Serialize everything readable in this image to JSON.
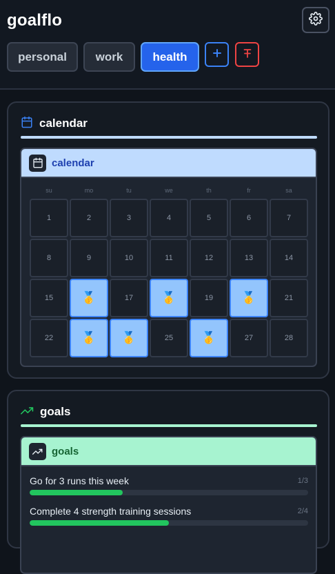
{
  "app": {
    "title": "goalflo"
  },
  "header": {
    "tabs": [
      {
        "label": "personal",
        "active": false
      },
      {
        "label": "work",
        "active": false
      },
      {
        "label": "health",
        "active": true
      }
    ],
    "add_icon": "plus",
    "delete_icon": "strikethrough-t",
    "settings_icon": "gear"
  },
  "calendar_section": {
    "title": "calendar",
    "card_title": "calendar",
    "weekdays": [
      "su",
      "mo",
      "tu",
      "we",
      "th",
      "fr",
      "sa"
    ],
    "days": [
      {
        "label": "1",
        "done": false
      },
      {
        "label": "2",
        "done": false
      },
      {
        "label": "3",
        "done": false
      },
      {
        "label": "4",
        "done": false
      },
      {
        "label": "5",
        "done": false
      },
      {
        "label": "6",
        "done": false
      },
      {
        "label": "7",
        "done": false
      },
      {
        "label": "8",
        "done": false
      },
      {
        "label": "9",
        "done": false
      },
      {
        "label": "10",
        "done": false
      },
      {
        "label": "11",
        "done": false
      },
      {
        "label": "12",
        "done": false
      },
      {
        "label": "13",
        "done": false
      },
      {
        "label": "14",
        "done": false
      },
      {
        "label": "15",
        "done": false
      },
      {
        "label": "🥇",
        "done": true
      },
      {
        "label": "17",
        "done": false
      },
      {
        "label": "🥇",
        "done": true
      },
      {
        "label": "19",
        "done": false
      },
      {
        "label": "🥇",
        "done": true
      },
      {
        "label": "21",
        "done": false
      },
      {
        "label": "22",
        "done": false
      },
      {
        "label": "🥇",
        "done": true
      },
      {
        "label": "🥇",
        "done": true
      },
      {
        "label": "25",
        "done": false
      },
      {
        "label": "🥇",
        "done": true
      },
      {
        "label": "27",
        "done": false
      },
      {
        "label": "28",
        "done": false
      }
    ]
  },
  "goals_section": {
    "title": "goals",
    "card_title": "goals",
    "items": [
      {
        "label": "Go for 3 runs this week",
        "count": "1/3",
        "progress": 0.333
      },
      {
        "label": "Complete 4 strength training sessions",
        "count": "2/4",
        "progress": 0.5
      }
    ]
  },
  "colors": {
    "accent": "#2563eb",
    "calendar_tint": "#bfdbfe",
    "goals_tint": "#a7f3d0",
    "progress": "#22c55e",
    "delete": "#ef4444"
  }
}
